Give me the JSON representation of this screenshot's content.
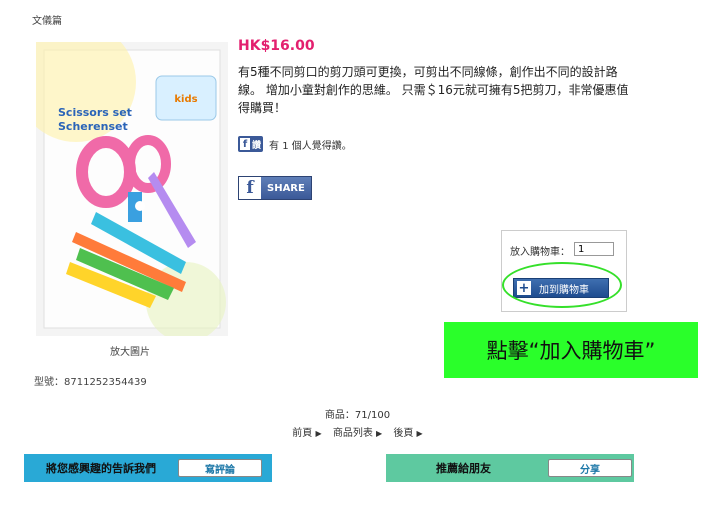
{
  "breadcrumb": "文儀篇",
  "product": {
    "price": "HK$16.00",
    "description": "有5種不同剪口的剪刀頭可更換，可剪出不同線條，創作出不同的設計路線。 增加小童對創作的思維。 只需＄16元就可擁有5把剪刀，非常優惠值得購買！",
    "image_text": {
      "line1": "Scissors set",
      "line2": "Scherenset",
      "badge": "kids"
    },
    "enlarge_label": "放大圖片",
    "sku_label": "型號：",
    "sku": "8711252354439"
  },
  "facebook": {
    "like_badge": "讚",
    "like_text": "有 1 個人覺得讚。",
    "share_label": "SHARE"
  },
  "cart": {
    "qty_label": "放入購物車：",
    "qty_value": "1",
    "add_button": "加到購物車"
  },
  "instruction": "點擊“加入購物車”",
  "pagination": {
    "count": "商品：71/100",
    "prev": "前頁",
    "list": "商品列表",
    "next": "後頁"
  },
  "footer": {
    "review_label": "將您感興趣的告訴我們",
    "review_button": "寫評論",
    "recommend_label": "推薦給朋友",
    "recommend_button": "分享"
  },
  "colors": {
    "price": "#e3206f",
    "instruction_bg": "#2aff2a",
    "review_bar": "#29a9d6",
    "recommend_bar": "#5ec9a0"
  }
}
